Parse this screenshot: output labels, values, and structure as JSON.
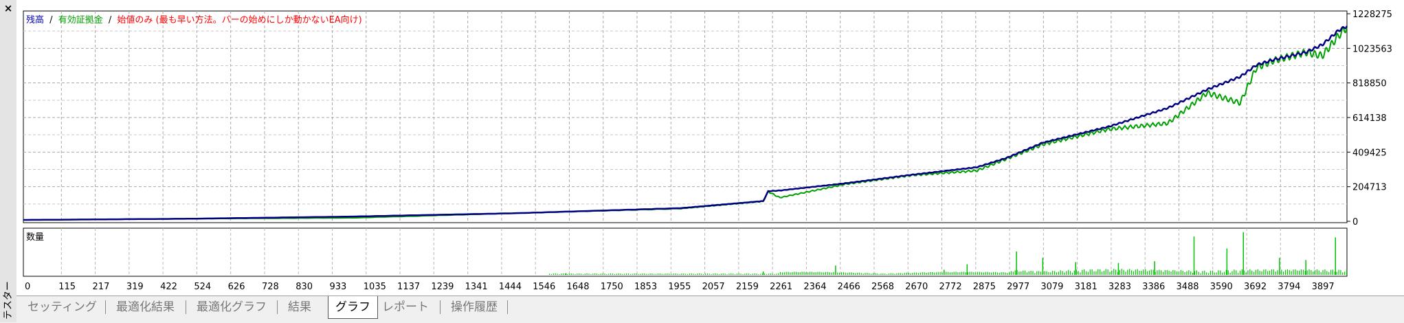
{
  "panel": {
    "title": "テスター",
    "close_glyph": "×"
  },
  "legend": {
    "balance": "残高",
    "equity": "有効証拠金",
    "method": "始値のみ (最も早い方法。バーの始めにしか動かないEA向け)",
    "sep": "/",
    "balance_color": "#0000b8",
    "equity_color": "#00a000",
    "method_color": "#ff0000"
  },
  "volume_label": "数量",
  "chart_data": [
    {
      "type": "line",
      "xlabel": "",
      "ylabel": "",
      "x": [
        0,
        500,
        1000,
        1500,
        2000,
        2250,
        2265,
        2300,
        2500,
        2700,
        2900,
        2990,
        3100,
        3300,
        3480,
        3600,
        3700,
        3750,
        3800,
        3900,
        3950,
        4000,
        4025
      ],
      "series": [
        {
          "name": "残高",
          "color": "#000080",
          "values": [
            8000,
            15000,
            28000,
            48000,
            78000,
            120000,
            178000,
            182000,
            225000,
            275000,
            320000,
            375000,
            465000,
            560000,
            670000,
            780000,
            855000,
            925000,
            955000,
            1000000,
            1045000,
            1130000,
            1155000
          ]
        },
        {
          "name": "有効証拠金",
          "color": "#00a000",
          "values": [
            8000,
            15000,
            20000,
            48000,
            75000,
            118000,
            176000,
            140000,
            220000,
            272000,
            300000,
            370000,
            455000,
            545000,
            580000,
            760000,
            700000,
            910000,
            950000,
            1000000,
            980000,
            1100000,
            1150000
          ]
        }
      ],
      "y_ticks": [
        "1228275",
        "1023563",
        "818850",
        "614138",
        "409425",
        "204713",
        "0"
      ],
      "ylim": [
        0,
        1228275
      ],
      "xlim": [
        0,
        4025
      ],
      "grid": true
    },
    {
      "type": "bar",
      "title": "数量",
      "color": "#00c000",
      "x_ticks": [
        "0",
        "115",
        "217",
        "319",
        "422",
        "524",
        "626",
        "728",
        "830",
        "933",
        "1035",
        "1137",
        "1239",
        "1341",
        "1444",
        "1546",
        "1648",
        "1750",
        "1853",
        "1955",
        "2057",
        "2159",
        "2261",
        "2364",
        "2466",
        "2568",
        "2670",
        "2772",
        "2875",
        "2977",
        "3079",
        "3181",
        "3283",
        "3386",
        "3488",
        "3590",
        "3692",
        "3794",
        "3897"
      ],
      "x_range": [
        0,
        4025
      ],
      "peaks": [
        {
          "x": 1650,
          "v": 0.04
        },
        {
          "x": 2250,
          "v": 0.08
        },
        {
          "x": 2470,
          "v": 0.22
        },
        {
          "x": 2800,
          "v": 0.12
        },
        {
          "x": 2870,
          "v": 0.25
        },
        {
          "x": 3020,
          "v": 0.55
        },
        {
          "x": 3100,
          "v": 0.4
        },
        {
          "x": 3200,
          "v": 0.3
        },
        {
          "x": 3330,
          "v": 0.28
        },
        {
          "x": 3440,
          "v": 0.32
        },
        {
          "x": 3560,
          "v": 0.9
        },
        {
          "x": 3660,
          "v": 0.62
        },
        {
          "x": 3710,
          "v": 1.0
        },
        {
          "x": 3820,
          "v": 0.4
        },
        {
          "x": 3900,
          "v": 0.35
        },
        {
          "x": 3990,
          "v": 0.88
        }
      ],
      "ylim": [
        0,
        1
      ]
    }
  ],
  "tabs": [
    {
      "id": "settings",
      "label": "セッティング",
      "active": false
    },
    {
      "id": "opt-results",
      "label": "最適化結果",
      "active": false
    },
    {
      "id": "opt-graph",
      "label": "最適化グラフ",
      "active": false
    },
    {
      "id": "results",
      "label": "結果",
      "active": false
    },
    {
      "id": "graph",
      "label": "グラフ",
      "active": true
    },
    {
      "id": "report",
      "label": "レポート",
      "active": false
    },
    {
      "id": "journal",
      "label": "操作履歴",
      "active": false
    }
  ]
}
